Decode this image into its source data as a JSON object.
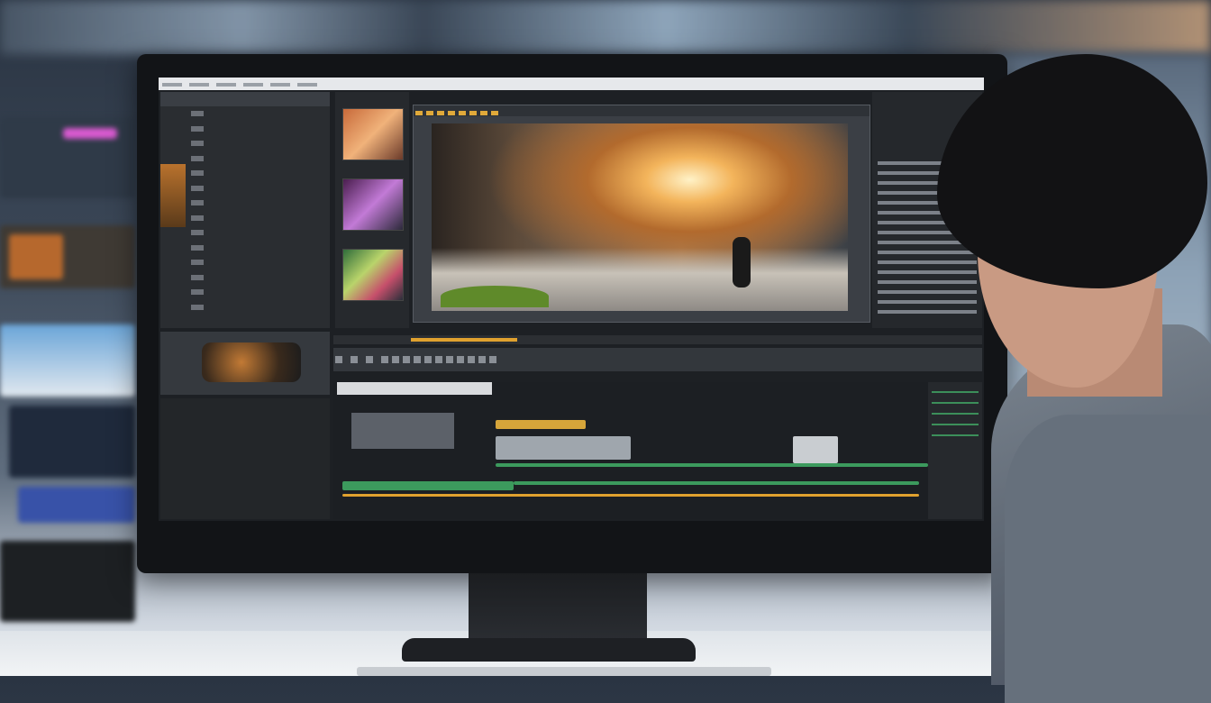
{
  "scene": {
    "description_tags": [
      "monitor",
      "video-editing-app",
      "person"
    ]
  },
  "app": {
    "left_panel_header": "",
    "media_rows": [
      "",
      "",
      "",
      "",
      "",
      "",
      "",
      "",
      "",
      "",
      "",
      "",
      "",
      "",
      ""
    ],
    "lower_rows": [
      "",
      "",
      "",
      "",
      ""
    ],
    "timeline_label": "",
    "icons": [
      "play-icon",
      "scissors-icon",
      "zoom-icon"
    ],
    "colors": {
      "accent": "#e0a12e",
      "track_green": "#3c9a5d",
      "panel": "#2a2d31"
    }
  }
}
